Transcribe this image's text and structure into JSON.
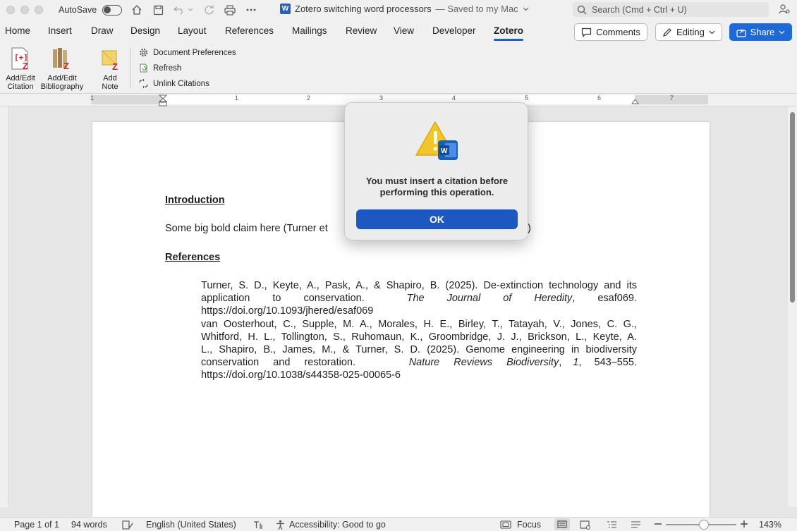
{
  "titlebar": {
    "autosave_label": "AutoSave",
    "doc_title": "Zotero switching word processors",
    "save_state": "— Saved to my Mac",
    "search_placeholder": "Search (Cmd + Ctrl + U)"
  },
  "menu": {
    "tabs": [
      "Home",
      "Insert",
      "Draw",
      "Design",
      "Layout",
      "References",
      "Mailings",
      "Review",
      "View",
      "Developer",
      "Zotero"
    ],
    "active_tab": "Zotero",
    "comments_label": "Comments",
    "editing_label": "Editing",
    "share_label": "Share"
  },
  "ribbon": {
    "add_edit_citation": [
      "Add/Edit",
      "Citation"
    ],
    "add_edit_bibliography": [
      "Add/Edit",
      "Bibliography"
    ],
    "add_note": [
      "Add",
      "Note"
    ],
    "doc_prefs": "Document Preferences",
    "refresh": "Refresh",
    "unlink": "Unlink Citations"
  },
  "ruler": {
    "numbers": [
      "1",
      "1",
      "2",
      "3",
      "4",
      "5",
      "6",
      "7"
    ]
  },
  "document": {
    "intro_heading": "Introduction",
    "body_line_start": "Some big bold claim here (Turner et",
    "body_line_end": ")",
    "refs_heading": "References",
    "ref1": {
      "line1": "Turner, S. D., Keyte, A., Pask, A., & Shapiro, B. (2025). De-extinction technology and its",
      "line2_plain": "application to conservation.",
      "line2_italic": "The Journal of Heredity",
      "line2_tail": ", esaf069.",
      "line3": "https://doi.org/10.1093/jhered/esaf069"
    },
    "ref2": {
      "line1": "van Oosterhout, C., Supple, M. A., Morales, H. E., Birley, T., Tatayah, V., Jones, C. G.,",
      "line2": "Whitford, H. L., Tollington, S., Ruhomaun, K., Groombridge, J. J., Brickson, L., Keyte, A.",
      "line3": "L., Shapiro, B., James, M., & Turner, S. D. (2025). Genome engineering in biodiversity",
      "line4_plain": "conservation and restoration.",
      "line4_italic": "Nature Reviews Biodiversity",
      "line4_mid": ",",
      "line4_vol": "1",
      "line4_tail": ", 543–555.",
      "line5": "https://doi.org/10.1038/s44358-025-00065-6"
    }
  },
  "dialog": {
    "message_line1": "You must insert a citation before",
    "message_line2": "performing this operation.",
    "ok_label": "OK"
  },
  "status": {
    "page": "Page 1 of 1",
    "words": "94 words",
    "language": "English (United States)",
    "accessibility": "Accessibility: Good to go",
    "focus": "Focus",
    "zoom": "143%"
  },
  "colors": {
    "accent": "#1f69d6",
    "dialog_button": "#1d57c2",
    "zotero_red": "#c1272d"
  }
}
